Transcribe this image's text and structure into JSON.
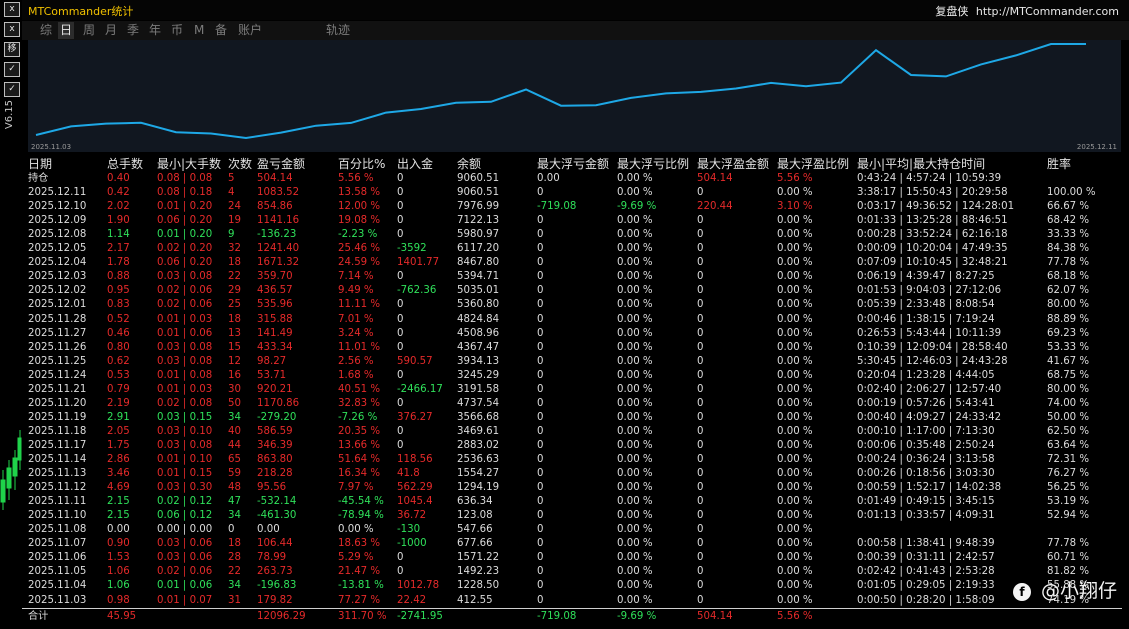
{
  "app": {
    "title": "MTCommander统计",
    "brand_name": "复盘侠",
    "brand_url": "http://MTCommander.com"
  },
  "left_toolbar": {
    "buttons": [
      "x",
      "x",
      "移",
      "✓",
      "✓"
    ],
    "vertical_text": "V6.15",
    "candle_color": "#1fd34a"
  },
  "tabs": [
    {
      "label": "综",
      "active": false
    },
    {
      "label": "日",
      "active": true
    },
    {
      "label": "周",
      "active": false
    },
    {
      "label": "月",
      "active": false
    },
    {
      "label": "季",
      "active": false
    },
    {
      "label": "年",
      "active": false
    },
    {
      "label": "币",
      "active": false
    },
    {
      "label": "M",
      "active": false
    },
    {
      "label": "备",
      "active": false
    },
    {
      "label": "账户",
      "active": false
    },
    {
      "label": "轨迹",
      "active": false
    }
  ],
  "equity_chart": {
    "type": "line",
    "start_label": "2025.11.03",
    "end_label": "2025.12.11",
    "line_color": "#1ea8e6",
    "values": [
      412.55,
      1228.5,
      1492.23,
      1571.22,
      677.66,
      547.66,
      123.08,
      636.34,
      1294.19,
      1554.27,
      2536.63,
      2883.02,
      3469.61,
      3566.68,
      4737.54,
      3191.58,
      3245.29,
      3934.13,
      4367.47,
      4508.96,
      4824.84,
      5360.8,
      5035.01,
      5394.71,
      8467.8,
      6117.2,
      5980.97,
      7122.13,
      7976.99,
      9060.51,
      9060.51
    ]
  },
  "table": {
    "headers": [
      "日期",
      "总手数",
      "最小|大手数",
      "次数",
      "盈亏金额",
      "百分比%",
      "出入金",
      "余额",
      "最大浮亏金额",
      "最大浮亏比例",
      "最大浮盈金额",
      "最大浮盈比例",
      "最小|平均|最大持仓时间",
      "胜率"
    ],
    "rows": [
      {
        "date": "持仓",
        "lots": "0.40",
        "minmax": "0.08 | 0.08",
        "count": "5",
        "pnl": "504.14",
        "pct": "5.56 %",
        "dw": "0",
        "bal": "9060.51",
        "ml": "0.00",
        "mlp": "0.00 %",
        "mp": "504.14",
        "mpp": "5.56 %",
        "time": "0:43:24 | 4:57:24 | 10:59:39",
        "win": "",
        "c": "r",
        "dwc": "w",
        "mlc": "w",
        "mlpc": "w",
        "mpc": "r",
        "mppc": "r"
      },
      {
        "date": "2025.12.11",
        "lots": "0.42",
        "minmax": "0.08 | 0.18",
        "count": "4",
        "pnl": "1083.52",
        "pct": "13.58 %",
        "dw": "0",
        "bal": "9060.51",
        "ml": "0",
        "mlp": "0.00 %",
        "mp": "0",
        "mpp": "0.00 %",
        "time": "3:38:17 | 15:50:43 | 20:29:58",
        "win": "100.00 %",
        "c": "r",
        "dwc": "w",
        "mlc": "w",
        "mlpc": "w",
        "mpc": "w",
        "mppc": "w"
      },
      {
        "date": "2025.12.10",
        "lots": "2.02",
        "minmax": "0.01 | 0.20",
        "count": "24",
        "pnl": "854.86",
        "pct": "12.00 %",
        "dw": "0",
        "bal": "7976.99",
        "ml": "-719.08",
        "mlp": "-9.69 %",
        "mp": "220.44",
        "mpp": "3.10 %",
        "time": "0:03:17 | 49:36:52 | 124:28:01",
        "win": "66.67 %",
        "c": "r",
        "dwc": "w",
        "mlc": "g",
        "mlpc": "g",
        "mpc": "r",
        "mppc": "r"
      },
      {
        "date": "2025.12.09",
        "lots": "1.90",
        "minmax": "0.06 | 0.20",
        "count": "19",
        "pnl": "1141.16",
        "pct": "19.08 %",
        "dw": "0",
        "bal": "7122.13",
        "ml": "0",
        "mlp": "0.00 %",
        "mp": "0",
        "mpp": "0.00 %",
        "time": "0:01:33 | 13:25:28 | 88:46:51",
        "win": "68.42 %",
        "c": "r",
        "dwc": "w",
        "mlc": "w",
        "mlpc": "w",
        "mpc": "w",
        "mppc": "w"
      },
      {
        "date": "2025.12.08",
        "lots": "1.14",
        "minmax": "0.01 | 0.20",
        "count": "9",
        "pnl": "-136.23",
        "pct": "-2.23 %",
        "dw": "0",
        "bal": "5980.97",
        "ml": "0",
        "mlp": "0.00 %",
        "mp": "0",
        "mpp": "0.00 %",
        "time": "0:00:28 | 33:52:24 | 62:16:18",
        "win": "33.33 %",
        "c": "g",
        "dwc": "w",
        "mlc": "w",
        "mlpc": "w",
        "mpc": "w",
        "mppc": "w"
      },
      {
        "date": "2025.12.05",
        "lots": "2.17",
        "minmax": "0.02 | 0.20",
        "count": "32",
        "pnl": "1241.40",
        "pct": "25.46 %",
        "dw": "-3592",
        "bal": "6117.20",
        "ml": "0",
        "mlp": "0.00 %",
        "mp": "0",
        "mpp": "0.00 %",
        "time": "0:00:09 | 10:20:04 | 47:49:35",
        "win": "84.38 %",
        "c": "r",
        "dwc": "g",
        "mlc": "w",
        "mlpc": "w",
        "mpc": "w",
        "mppc": "w"
      },
      {
        "date": "2025.12.04",
        "lots": "1.78",
        "minmax": "0.06 | 0.20",
        "count": "18",
        "pnl": "1671.32",
        "pct": "24.59 %",
        "dw": "1401.77",
        "bal": "8467.80",
        "ml": "0",
        "mlp": "0.00 %",
        "mp": "0",
        "mpp": "0.00 %",
        "time": "0:07:09 | 10:10:45 | 32:48:21",
        "win": "77.78 %",
        "c": "r",
        "dwc": "r",
        "mlc": "w",
        "mlpc": "w",
        "mpc": "w",
        "mppc": "w"
      },
      {
        "date": "2025.12.03",
        "lots": "0.88",
        "minmax": "0.03 | 0.08",
        "count": "22",
        "pnl": "359.70",
        "pct": "7.14 %",
        "dw": "0",
        "bal": "5394.71",
        "ml": "0",
        "mlp": "0.00 %",
        "mp": "0",
        "mpp": "0.00 %",
        "time": "0:06:19 | 4:39:47 | 8:27:25",
        "win": "68.18 %",
        "c": "r",
        "dwc": "w",
        "mlc": "w",
        "mlpc": "w",
        "mpc": "w",
        "mppc": "w"
      },
      {
        "date": "2025.12.02",
        "lots": "0.95",
        "minmax": "0.02 | 0.06",
        "count": "29",
        "pnl": "436.57",
        "pct": "9.49 %",
        "dw": "-762.36",
        "bal": "5035.01",
        "ml": "0",
        "mlp": "0.00 %",
        "mp": "0",
        "mpp": "0.00 %",
        "time": "0:01:53 | 9:04:03 | 27:12:06",
        "win": "62.07 %",
        "c": "r",
        "dwc": "g",
        "mlc": "w",
        "mlpc": "w",
        "mpc": "w",
        "mppc": "w"
      },
      {
        "date": "2025.12.01",
        "lots": "0.83",
        "minmax": "0.02 | 0.06",
        "count": "25",
        "pnl": "535.96",
        "pct": "11.11 %",
        "dw": "0",
        "bal": "5360.80",
        "ml": "0",
        "mlp": "0.00 %",
        "mp": "0",
        "mpp": "0.00 %",
        "time": "0:05:39 | 2:33:48 | 8:08:54",
        "win": "80.00 %",
        "c": "r",
        "dwc": "w",
        "mlc": "w",
        "mlpc": "w",
        "mpc": "w",
        "mppc": "w"
      },
      {
        "date": "2025.11.28",
        "lots": "0.52",
        "minmax": "0.01 | 0.03",
        "count": "18",
        "pnl": "315.88",
        "pct": "7.01 %",
        "dw": "0",
        "bal": "4824.84",
        "ml": "0",
        "mlp": "0.00 %",
        "mp": "0",
        "mpp": "0.00 %",
        "time": "0:00:46 | 1:38:15 | 7:19:24",
        "win": "88.89 %",
        "c": "r",
        "dwc": "w",
        "mlc": "w",
        "mlpc": "w",
        "mpc": "w",
        "mppc": "w"
      },
      {
        "date": "2025.11.27",
        "lots": "0.46",
        "minmax": "0.01 | 0.06",
        "count": "13",
        "pnl": "141.49",
        "pct": "3.24 %",
        "dw": "0",
        "bal": "4508.96",
        "ml": "0",
        "mlp": "0.00 %",
        "mp": "0",
        "mpp": "0.00 %",
        "time": "0:26:53 | 5:43:44 | 10:11:39",
        "win": "69.23 %",
        "c": "r",
        "dwc": "w",
        "mlc": "w",
        "mlpc": "w",
        "mpc": "w",
        "mppc": "w"
      },
      {
        "date": "2025.11.26",
        "lots": "0.80",
        "minmax": "0.03 | 0.08",
        "count": "15",
        "pnl": "433.34",
        "pct": "11.01 %",
        "dw": "0",
        "bal": "4367.47",
        "ml": "0",
        "mlp": "0.00 %",
        "mp": "0",
        "mpp": "0.00 %",
        "time": "0:10:39 | 12:09:04 | 28:58:40",
        "win": "53.33 %",
        "c": "r",
        "dwc": "w",
        "mlc": "w",
        "mlpc": "w",
        "mpc": "w",
        "mppc": "w"
      },
      {
        "date": "2025.11.25",
        "lots": "0.62",
        "minmax": "0.03 | 0.08",
        "count": "12",
        "pnl": "98.27",
        "pct": "2.56 %",
        "dw": "590.57",
        "bal": "3934.13",
        "ml": "0",
        "mlp": "0.00 %",
        "mp": "0",
        "mpp": "0.00 %",
        "time": "5:30:45 | 12:46:03 | 24:43:28",
        "win": "41.67 %",
        "c": "r",
        "dwc": "r",
        "mlc": "w",
        "mlpc": "w",
        "mpc": "w",
        "mppc": "w"
      },
      {
        "date": "2025.11.24",
        "lots": "0.53",
        "minmax": "0.01 | 0.08",
        "count": "16",
        "pnl": "53.71",
        "pct": "1.68 %",
        "dw": "0",
        "bal": "3245.29",
        "ml": "0",
        "mlp": "0.00 %",
        "mp": "0",
        "mpp": "0.00 %",
        "time": "0:20:04 | 1:23:28 | 4:44:05",
        "win": "68.75 %",
        "c": "r",
        "dwc": "w",
        "mlc": "w",
        "mlpc": "w",
        "mpc": "w",
        "mppc": "w"
      },
      {
        "date": "2025.11.21",
        "lots": "0.79",
        "minmax": "0.01 | 0.03",
        "count": "30",
        "pnl": "920.21",
        "pct": "40.51 %",
        "dw": "-2466.17",
        "bal": "3191.58",
        "ml": "0",
        "mlp": "0.00 %",
        "mp": "0",
        "mpp": "0.00 %",
        "time": "0:02:40 | 2:06:27 | 12:57:40",
        "win": "80.00 %",
        "c": "r",
        "dwc": "g",
        "mlc": "w",
        "mlpc": "w",
        "mpc": "w",
        "mppc": "w"
      },
      {
        "date": "2025.11.20",
        "lots": "2.19",
        "minmax": "0.02 | 0.08",
        "count": "50",
        "pnl": "1170.86",
        "pct": "32.83 %",
        "dw": "0",
        "bal": "4737.54",
        "ml": "0",
        "mlp": "0.00 %",
        "mp": "0",
        "mpp": "0.00 %",
        "time": "0:00:19 | 0:57:26 | 5:43:41",
        "win": "74.00 %",
        "c": "r",
        "dwc": "w",
        "mlc": "w",
        "mlpc": "w",
        "mpc": "w",
        "mppc": "w"
      },
      {
        "date": "2025.11.19",
        "lots": "2.91",
        "minmax": "0.03 | 0.15",
        "count": "34",
        "pnl": "-279.20",
        "pct": "-7.26 %",
        "dw": "376.27",
        "bal": "3566.68",
        "ml": "0",
        "mlp": "0.00 %",
        "mp": "0",
        "mpp": "0.00 %",
        "time": "0:00:40 | 4:09:27 | 24:33:42",
        "win": "50.00 %",
        "c": "g",
        "dwc": "r",
        "mlc": "w",
        "mlpc": "w",
        "mpc": "w",
        "mppc": "w"
      },
      {
        "date": "2025.11.18",
        "lots": "2.05",
        "minmax": "0.03 | 0.10",
        "count": "40",
        "pnl": "586.59",
        "pct": "20.35 %",
        "dw": "0",
        "bal": "3469.61",
        "ml": "0",
        "mlp": "0.00 %",
        "mp": "0",
        "mpp": "0.00 %",
        "time": "0:00:10 | 1:17:00 | 7:13:30",
        "win": "62.50 %",
        "c": "r",
        "dwc": "w",
        "mlc": "w",
        "mlpc": "w",
        "mpc": "w",
        "mppc": "w"
      },
      {
        "date": "2025.11.17",
        "lots": "1.75",
        "minmax": "0.03 | 0.08",
        "count": "44",
        "pnl": "346.39",
        "pct": "13.66 %",
        "dw": "0",
        "bal": "2883.02",
        "ml": "0",
        "mlp": "0.00 %",
        "mp": "0",
        "mpp": "0.00 %",
        "time": "0:00:06 | 0:35:48 | 2:50:24",
        "win": "63.64 %",
        "c": "r",
        "dwc": "w",
        "mlc": "w",
        "mlpc": "w",
        "mpc": "w",
        "mppc": "w"
      },
      {
        "date": "2025.11.14",
        "lots": "2.86",
        "minmax": "0.01 | 0.10",
        "count": "65",
        "pnl": "863.80",
        "pct": "51.64 %",
        "dw": "118.56",
        "bal": "2536.63",
        "ml": "0",
        "mlp": "0.00 %",
        "mp": "0",
        "mpp": "0.00 %",
        "time": "0:00:24 | 0:36:24 | 3:13:58",
        "win": "72.31 %",
        "c": "r",
        "dwc": "r",
        "mlc": "w",
        "mlpc": "w",
        "mpc": "w",
        "mppc": "w"
      },
      {
        "date": "2025.11.13",
        "lots": "3.46",
        "minmax": "0.01 | 0.15",
        "count": "59",
        "pnl": "218.28",
        "pct": "16.34 %",
        "dw": "41.8",
        "bal": "1554.27",
        "ml": "0",
        "mlp": "0.00 %",
        "mp": "0",
        "mpp": "0.00 %",
        "time": "0:00:26 | 0:18:56 | 3:03:30",
        "win": "76.27 %",
        "c": "r",
        "dwc": "r",
        "mlc": "w",
        "mlpc": "w",
        "mpc": "w",
        "mppc": "w"
      },
      {
        "date": "2025.11.12",
        "lots": "4.69",
        "minmax": "0.03 | 0.30",
        "count": "48",
        "pnl": "95.56",
        "pct": "7.97 %",
        "dw": "562.29",
        "bal": "1294.19",
        "ml": "0",
        "mlp": "0.00 %",
        "mp": "0",
        "mpp": "0.00 %",
        "time": "0:00:59 | 1:52:17 | 14:02:38",
        "win": "56.25 %",
        "c": "r",
        "dwc": "r",
        "mlc": "w",
        "mlpc": "w",
        "mpc": "w",
        "mppc": "w"
      },
      {
        "date": "2025.11.11",
        "lots": "2.15",
        "minmax": "0.02 | 0.12",
        "count": "47",
        "pnl": "-532.14",
        "pct": "-45.54 %",
        "dw": "1045.4",
        "bal": "636.34",
        "ml": "0",
        "mlp": "0.00 %",
        "mp": "0",
        "mpp": "0.00 %",
        "time": "0:01:49 | 0:49:15 | 3:45:15",
        "win": "53.19 %",
        "c": "g",
        "dwc": "r",
        "mlc": "w",
        "mlpc": "w",
        "mpc": "w",
        "mppc": "w"
      },
      {
        "date": "2025.11.10",
        "lots": "2.15",
        "minmax": "0.06 | 0.12",
        "count": "34",
        "pnl": "-461.30",
        "pct": "-78.94 %",
        "dw": "36.72",
        "bal": "123.08",
        "ml": "0",
        "mlp": "0.00 %",
        "mp": "0",
        "mpp": "0.00 %",
        "time": "0:01:13 | 0:33:57 | 4:09:31",
        "win": "52.94 %",
        "c": "g",
        "dwc": "r",
        "mlc": "w",
        "mlpc": "w",
        "mpc": "w",
        "mppc": "w"
      },
      {
        "date": "2025.11.08",
        "lots": "0.00",
        "minmax": "0.00 | 0.00",
        "count": "0",
        "pnl": "0.00",
        "pct": "0.00 %",
        "dw": "-130",
        "bal": "547.66",
        "ml": "0",
        "mlp": "0.00 %",
        "mp": "0",
        "mpp": "0.00 %",
        "time": "",
        "win": "",
        "c": "w",
        "dwc": "g",
        "mlc": "w",
        "mlpc": "w",
        "mpc": "w",
        "mppc": "w"
      },
      {
        "date": "2025.11.07",
        "lots": "0.90",
        "minmax": "0.03 | 0.06",
        "count": "18",
        "pnl": "106.44",
        "pct": "18.63 %",
        "dw": "-1000",
        "bal": "677.66",
        "ml": "0",
        "mlp": "0.00 %",
        "mp": "0",
        "mpp": "0.00 %",
        "time": "0:00:58 | 1:38:41 | 9:48:39",
        "win": "77.78 %",
        "c": "r",
        "dwc": "g",
        "mlc": "w",
        "mlpc": "w",
        "mpc": "w",
        "mppc": "w"
      },
      {
        "date": "2025.11.06",
        "lots": "1.53",
        "minmax": "0.03 | 0.06",
        "count": "28",
        "pnl": "78.99",
        "pct": "5.29 %",
        "dw": "0",
        "bal": "1571.22",
        "ml": "0",
        "mlp": "0.00 %",
        "mp": "0",
        "mpp": "0.00 %",
        "time": "0:00:39 | 0:31:11 | 2:42:57",
        "win": "60.71 %",
        "c": "r",
        "dwc": "w",
        "mlc": "w",
        "mlpc": "w",
        "mpc": "w",
        "mppc": "w"
      },
      {
        "date": "2025.11.05",
        "lots": "1.06",
        "minmax": "0.02 | 0.06",
        "count": "22",
        "pnl": "263.73",
        "pct": "21.47 %",
        "dw": "0",
        "bal": "1492.23",
        "ml": "0",
        "mlp": "0.00 %",
        "mp": "0",
        "mpp": "0.00 %",
        "time": "0:02:42 | 0:41:43 | 2:53:28",
        "win": "81.82 %",
        "c": "r",
        "dwc": "w",
        "mlc": "w",
        "mlpc": "w",
        "mpc": "w",
        "mppc": "w"
      },
      {
        "date": "2025.11.04",
        "lots": "1.06",
        "minmax": "0.01 | 0.06",
        "count": "34",
        "pnl": "-196.83",
        "pct": "-13.81 %",
        "dw": "1012.78",
        "bal": "1228.50",
        "ml": "0",
        "mlp": "0.00 %",
        "mp": "0",
        "mpp": "0.00 %",
        "time": "0:01:05 | 0:29:05 | 2:19:33",
        "win": "55.88 %",
        "c": "g",
        "dwc": "r",
        "mlc": "w",
        "mlpc": "w",
        "mpc": "w",
        "mppc": "w"
      },
      {
        "date": "2025.11.03",
        "lots": "0.98",
        "minmax": "0.01 | 0.07",
        "count": "31",
        "pnl": "179.82",
        "pct": "77.27 %",
        "dw": "22.42",
        "bal": "412.55",
        "ml": "0",
        "mlp": "0.00 %",
        "mp": "0",
        "mpp": "0.00 %",
        "time": "0:00:50 | 0:28:20 | 1:58:09",
        "win": "74.19 %",
        "c": "r",
        "dwc": "r",
        "mlc": "w",
        "mlpc": "w",
        "mpc": "w",
        "mppc": "w"
      }
    ],
    "total": {
      "date": "合计",
      "lots": "45.95",
      "minmax": "",
      "count": "",
      "pnl": "12096.29",
      "pct": "311.70 %",
      "dw": "-2741.95",
      "bal": "",
      "ml": "-719.08",
      "mlp": "-9.69 %",
      "mp": "504.14",
      "mpp": "5.56 %",
      "time": "",
      "win": "",
      "c": "r",
      "dwc": "g",
      "mlc": "g",
      "mlpc": "g",
      "mpc": "r",
      "mppc": "r"
    }
  },
  "watermark": {
    "logo": "f",
    "text": "@小翔仔"
  }
}
